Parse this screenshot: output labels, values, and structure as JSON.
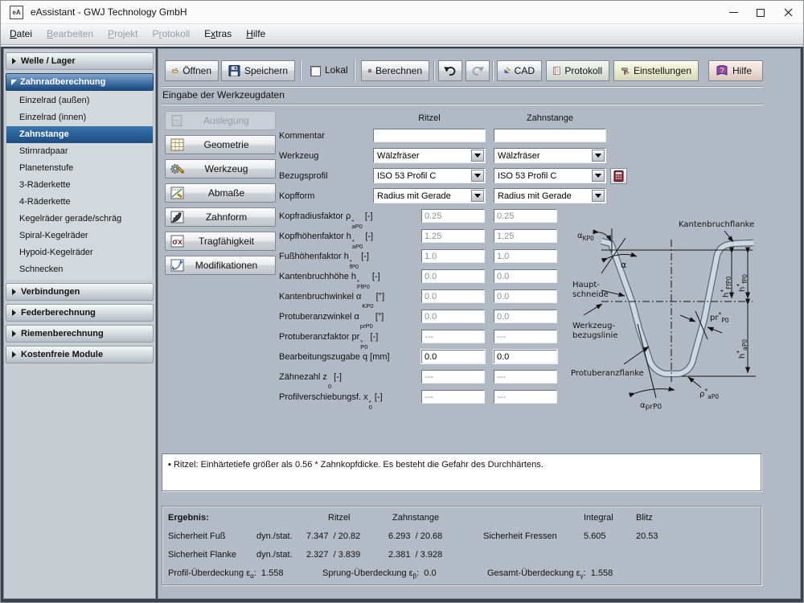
{
  "window": {
    "title": "eAssistant - GWJ Technology GmbH",
    "icon_text": "eA"
  },
  "menu": {
    "items": [
      {
        "id": "datei",
        "label": "Datei",
        "underline": 0,
        "enabled": true
      },
      {
        "id": "bearbeiten",
        "label": "Bearbeiten",
        "underline": 0,
        "enabled": false
      },
      {
        "id": "projekt",
        "label": "Projekt",
        "underline": 0,
        "enabled": false
      },
      {
        "id": "protokoll",
        "label": "Protokoll",
        "underline": 1,
        "enabled": false
      },
      {
        "id": "extras",
        "label": "Extras",
        "underline": 1,
        "enabled": true
      },
      {
        "id": "hilfe",
        "label": "Hilfe",
        "underline": 0,
        "enabled": true
      }
    ]
  },
  "sidebar": {
    "sections": [
      {
        "id": "welle-lager",
        "label": "Welle / Lager",
        "expanded": false
      },
      {
        "id": "zahnradberechnung",
        "label": "Zahnradberechnung",
        "expanded": true,
        "items": [
          {
            "label": "Einzelrad (außen)"
          },
          {
            "label": "Einzelrad (innen)"
          },
          {
            "label": "Zahnstange",
            "selected": true
          },
          {
            "label": "Stirnradpaar"
          },
          {
            "label": "Planetenstufe"
          },
          {
            "label": "3-Räderkette"
          },
          {
            "label": "4-Räderkette"
          },
          {
            "label": "Kegelräder gerade/schräg"
          },
          {
            "label": "Spiral-Kegelräder"
          },
          {
            "label": "Hypoid-Kegelräder"
          },
          {
            "label": "Schnecken"
          }
        ]
      },
      {
        "id": "verbindungen",
        "label": "Verbindungen",
        "expanded": false
      },
      {
        "id": "federberechnung",
        "label": "Federberechnung",
        "expanded": false
      },
      {
        "id": "riemenberechnung",
        "label": "Riemenberechnung",
        "expanded": false
      },
      {
        "id": "kostenfreie-module",
        "label": "Kostenfreie Module",
        "expanded": false
      }
    ]
  },
  "toolbar": {
    "open": "Öffnen",
    "save": "Speichern",
    "local": "Lokal",
    "calculate": "Berechnen",
    "cad": "CAD",
    "protocol": "Protokoll",
    "settings": "Einstellungen",
    "help": "Hilfe",
    "help_icon_glyph": "?"
  },
  "content": {
    "section_title": "Eingabe der Werkzeugdaten",
    "nav": [
      {
        "id": "auslegung",
        "label": "Auslegung",
        "enabled": false
      },
      {
        "id": "geometrie",
        "label": "Geometrie",
        "enabled": true
      },
      {
        "id": "werkzeug",
        "label": "Werkzeug",
        "enabled": true
      },
      {
        "id": "abmasse",
        "label": "Abmaße",
        "enabled": true
      },
      {
        "id": "zahnform",
        "label": "Zahnform",
        "enabled": true
      },
      {
        "id": "tragfaehigkeit",
        "label": "Tragfähigkeit",
        "enabled": true,
        "icon_glyph": "σx"
      },
      {
        "id": "modifikationen",
        "label": "Modifikationen",
        "enabled": true
      }
    ],
    "columns": {
      "col1": "Ritzel",
      "col2": "Zahnstange"
    },
    "rows": [
      {
        "id": "kommentar",
        "label": "Kommentar",
        "type": "text",
        "v1": "",
        "v2": ""
      },
      {
        "id": "werkzeug",
        "label": "Werkzeug",
        "type": "select",
        "v1": "Wälzfräser",
        "v2": "Wälzfräser"
      },
      {
        "id": "bezugsprofil",
        "label": "Bezugsprofil",
        "type": "select",
        "v1": "ISO 53 Profil C",
        "v2": "ISO 53 Profil C",
        "extra_button": true
      },
      {
        "id": "kopfform",
        "label": "Kopfform",
        "type": "select",
        "v1": "Radius mit Gerade",
        "v2": "Radius mit Gerade"
      },
      {
        "id": "kopfradiusfaktor",
        "label": "Kopfradiusfaktor",
        "sym": "ρ",
        "sup": "*",
        "sub": "aP0",
        "unit": "[-]",
        "type": "param",
        "v1": "0.25",
        "v2": "0.25",
        "enabled": false
      },
      {
        "id": "kopfhoehenfaktor",
        "label": "Kopfhöhenfaktor",
        "sym": "h",
        "sup": "*",
        "sub": "aP0",
        "unit": "[-]",
        "type": "param",
        "v1": "1.25",
        "v2": "1.25",
        "enabled": false
      },
      {
        "id": "fusshoehenfaktor",
        "label": "Fußhöhenfaktor",
        "sym": "h",
        "sup": "*",
        "sub": "fP0",
        "unit": "[-]",
        "type": "param",
        "v1": "1.0",
        "v2": "1.0",
        "enabled": false
      },
      {
        "id": "kantenbruchhoehe",
        "label": "Kantenbruchhöhe",
        "sym": "h",
        "sup": "*",
        "sub": "FfP0",
        "unit": "[-]",
        "type": "param",
        "v1": "0.0",
        "v2": "0.0",
        "enabled": false
      },
      {
        "id": "kantenbruchwinkel",
        "label": "Kantenbruchwinkel",
        "sym": "α",
        "sup": "",
        "sub": "KP0",
        "unit": "[°]",
        "type": "param",
        "v1": "0.0",
        "v2": "0.0",
        "enabled": false
      },
      {
        "id": "protuberanzwinkel",
        "label": "Protuberanzwinkel",
        "sym": "α",
        "sup": "",
        "sub": "prP0",
        "unit": "[°]",
        "type": "param",
        "v1": "0.0",
        "v2": "0.0",
        "enabled": false
      },
      {
        "id": "protuberanzfaktor",
        "label": "Protuberanzfaktor",
        "sym": "pr",
        "sup": "*",
        "sub": "P0",
        "unit": "[-]",
        "type": "param",
        "v1": "---",
        "v2": "---",
        "enabled": false
      },
      {
        "id": "bearbeitungszugabe",
        "label": "Bearbeitungszugabe",
        "sym": "q",
        "sup": "",
        "sub": "",
        "unit": "[mm]",
        "type": "param",
        "v1": "0.0",
        "v2": "0.0",
        "enabled": true
      },
      {
        "id": "zaehnezahl",
        "label": "Zähnezahl",
        "sym": "z",
        "sup": "",
        "sub": "0",
        "unit": "[-]",
        "type": "param",
        "v1": "---",
        "v2": "---",
        "enabled": false
      },
      {
        "id": "profilverschiebungsf",
        "label": "Profilverschiebungsf.",
        "sym": "x",
        "sup": "*",
        "sub": "0",
        "unit": "[-]",
        "type": "param",
        "v1": "---",
        "v2": "---",
        "enabled": false
      }
    ],
    "message": "▪ Ritzel: Einhärtetiefe größer als 0.56 * Zahnkopfdicke. Es besteht die Gefahr des Durchhärtens.",
    "results": {
      "title": "Ergebnis:",
      "col_ritzel": "Ritzel",
      "col_zahnstange": "Zahnstange",
      "col_integral": "Integral",
      "col_blitz": "Blitz",
      "rows": [
        {
          "label": "Sicherheit Fuß",
          "mode": "dyn./stat.",
          "v1": "7.347  / 20.82",
          "v2": "6.293  / 20.68"
        },
        {
          "label": "Sicherheit Flanke",
          "mode": "dyn./stat.",
          "v1": "2.327  / 3.839",
          "v2": "2.381  / 3.928"
        }
      ],
      "fressen": {
        "label": "Sicherheit Fressen",
        "integral": "5.605",
        "blitz": "20.53"
      },
      "overlap": [
        {
          "pre": "Profil-Überdeckung ε",
          "sub": "α",
          "value": ":  1.558"
        },
        {
          "pre": "Sprung-Überdeckung ε",
          "sub": "β",
          "value": ":  0.0"
        },
        {
          "pre": "Gesamt-Überdeckung ε",
          "sub": "γ",
          "value": ":  1.558"
        }
      ]
    }
  },
  "diagram": {
    "kantenbruchflanke": "Kantenbruchflanke",
    "alpha_kpo_base": "α",
    "alpha_kpo_sub": "KP0",
    "alpha": "α",
    "haupt1": "Haupt-",
    "haupt2": "schneide",
    "wbz1": "Werkzeug-",
    "wbz2": "bezugslinie",
    "pr_base": "pr",
    "pr_sup": "*",
    "pr_sub": "P0",
    "h_ffp0_base": "h",
    "h_ffp0_sup": "*",
    "h_ffp0_sub": "FfP0",
    "h_fp0_base": "h",
    "h_fp0_sup": "*",
    "h_fp0_sub": "fP0",
    "h_ap0_base": "h",
    "h_ap0_sup": "*",
    "h_ap0_sub": "aP0",
    "protuberanzflanke": "Protuberanzflanke",
    "rho_base": "ρ",
    "rho_sup": "*",
    "rho_sub": "aP0",
    "alpha_prp0_base": "α",
    "alpha_prp0_sub": "prP0"
  },
  "colors": {
    "accent_blue": "#1d4f87",
    "selected_blue": "#1e5a9a",
    "panel_bg": "#b1bac4",
    "profile_fill": "#ccd8e3"
  }
}
